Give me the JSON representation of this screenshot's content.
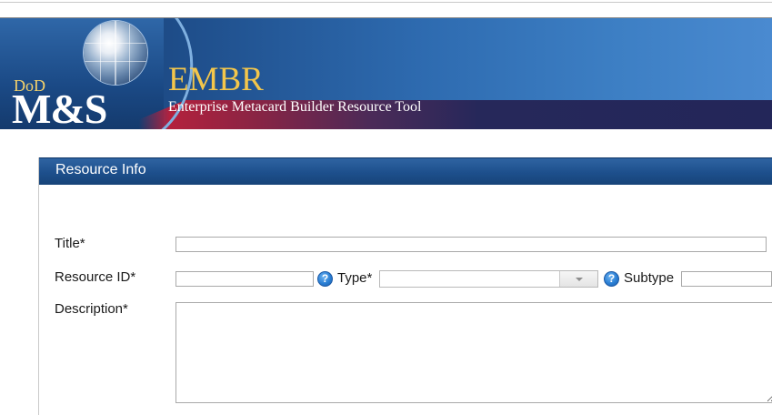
{
  "header": {
    "logo_dod": "DoD",
    "logo_ms": "M&S",
    "app_name": "EMBR",
    "app_subtitle": "Enterprise Metacard Builder Resource Tool",
    "colors": {
      "brand_blue": "#1f4f8c",
      "gold": "#f3c64b",
      "accent_red": "#b3213d"
    }
  },
  "panel": {
    "title": "Resource Info"
  },
  "form": {
    "title_label": "Title*",
    "title_value": "",
    "resource_id_label": "Resource ID*",
    "resource_id_value": "",
    "type_label": "Type*",
    "type_value": "",
    "subtype_label": "Subtype",
    "subtype_value": "",
    "description_label": "Description*",
    "description_value": "",
    "help_icon": "question-mark-icon"
  }
}
